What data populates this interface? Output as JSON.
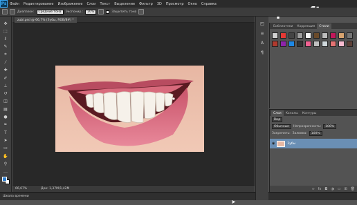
{
  "app": {
    "logo": "Ps"
  },
  "menu": [
    "Файл",
    "Редактирование",
    "Изображение",
    "Слои",
    "Текст",
    "Выделение",
    "Фильтр",
    "3D",
    "Просмотр",
    "Окно",
    "Справка"
  ],
  "watermark": "psraft.ru",
  "options": {
    "mode_label": "Диапазон:",
    "mode_value": "Средние тона",
    "exposure_label": "Экспонир.:",
    "exposure_value": "20%",
    "protect_label": "Защитить тона"
  },
  "document": {
    "tab_title": "zubi.psd @ 66,7% (Зубы, RGB/8#) *",
    "zoom": "66,67%",
    "doc_size": "Док: 1,37M/1,42M"
  },
  "timeline_label": "Шкала времени",
  "tools": [
    "move",
    "marquee",
    "lasso",
    "quick-select",
    "crop",
    "eyedropper",
    "heal",
    "brush",
    "stamp",
    "history",
    "eraser",
    "gradient",
    "dodge",
    "pen",
    "text",
    "path-select",
    "shape",
    "hand",
    "zoom",
    "more"
  ],
  "panel_top": {
    "tabs": [
      "Библиотеки",
      "Коррекция",
      "Стили"
    ],
    "active_tab": "Стили",
    "style_colors": [
      "#d0d0d0",
      "#e53935",
      "#444444",
      "#9e9e9e",
      "#f5f5f5",
      "#6a4a2a",
      "#bdbdbd",
      "#c2185b",
      "#d7a36f",
      "#757575",
      "#b03a2e",
      "#8e24aa",
      "#1e88e5",
      "#333333",
      "#f06292",
      "#c0c0c0",
      "#cfd8dc",
      "#e57373",
      "#f8bbd0",
      "#5d4037"
    ]
  },
  "panel_layers": {
    "tabs": [
      "Слои",
      "Каналы",
      "Контуры"
    ],
    "active_tab": "Слои",
    "filter": "Вид",
    "blend_mode": "Обычные",
    "opacity_label": "Непрозрачность:",
    "opacity_value": "100%",
    "lock_label": "Закрепить:",
    "fill_label": "Заливка:",
    "fill_value": "100%",
    "layers": [
      {
        "name": "Зубы"
      }
    ]
  }
}
